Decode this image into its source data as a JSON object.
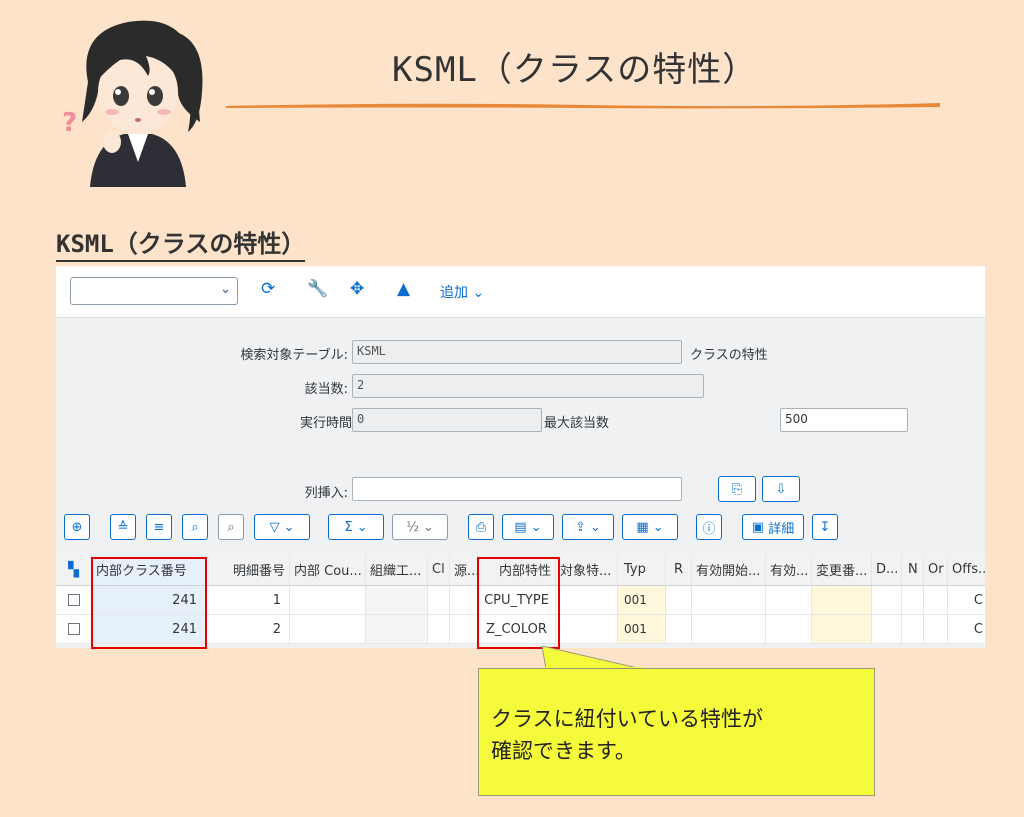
{
  "header": {
    "title": "KSML（クラスの特性）",
    "section_title": "KSML（クラスの特性）"
  },
  "toolbar": {
    "add_label": "追加"
  },
  "form": {
    "table_label": "検索対象テーブル:",
    "table_value": "KSML",
    "table_desc": "クラスの特性",
    "hits_label": "該当数:",
    "hits_value": "2",
    "runtime_label": "実行時間",
    "runtime_value": "0",
    "max_hits_label": "最大該当数",
    "max_hits_value": "500",
    "col_insert_label": "列挿入:"
  },
  "table": {
    "detail_label": "詳細",
    "columns": [
      "内部クラス番号",
      "明細番号",
      "内部 Cou...",
      "組織工...",
      "Cl",
      "源...",
      "内部特性",
      "対象特...",
      "Typ",
      "R",
      "有効開始...",
      "有効...",
      "変更番...",
      "D...",
      "N",
      "Or",
      "Offs..."
    ],
    "rows": [
      {
        "class_no": "241",
        "item_no": "1",
        "char": "CPU_TYPE",
        "typ": "001",
        "offs": "C"
      },
      {
        "class_no": "241",
        "item_no": "2",
        "char": "Z_COLOR",
        "typ": "001",
        "offs": "C"
      }
    ]
  },
  "callout": {
    "line1": "クラスに紐付いている特性が",
    "line2": "確認できます。"
  },
  "colors": {
    "background": "#fce3c9",
    "accent": "#0a6ed1",
    "highlight": "#e60000",
    "callout": "#f5fb3a"
  }
}
